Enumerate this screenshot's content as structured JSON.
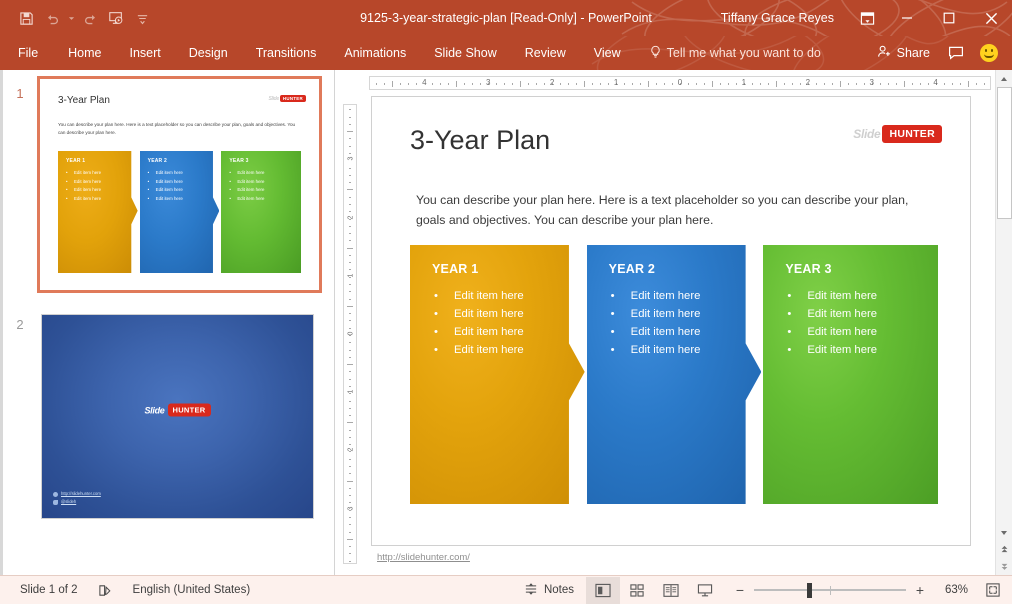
{
  "titlebar": {
    "document_title": "9125-3-year-strategic-plan [Read-Only]  -  PowerPoint",
    "user_name": "Tiffany Grace Reyes",
    "qat": [
      {
        "name": "save-icon",
        "label": "Save"
      },
      {
        "name": "undo-icon",
        "label": "Undo"
      },
      {
        "name": "undo-dropdown-icon",
        "label": "Undo options"
      },
      {
        "name": "redo-icon",
        "label": "Redo"
      },
      {
        "name": "start-presentation-icon",
        "label": "Start From Beginning"
      },
      {
        "name": "customize-qat-icon",
        "label": "Customize Quick Access Toolbar"
      }
    ],
    "window_controls": [
      {
        "name": "ribbon-display-options-icon",
        "label": "Ribbon Display Options"
      },
      {
        "name": "minimize-icon",
        "label": "Minimize"
      },
      {
        "name": "maximize-icon",
        "label": "Restore Down"
      },
      {
        "name": "close-icon",
        "label": "Close"
      }
    ]
  },
  "ribbon": {
    "tabs": [
      {
        "label": "File"
      },
      {
        "label": "Home"
      },
      {
        "label": "Insert"
      },
      {
        "label": "Design"
      },
      {
        "label": "Transitions"
      },
      {
        "label": "Animations"
      },
      {
        "label": "Slide Show"
      },
      {
        "label": "Review"
      },
      {
        "label": "View"
      }
    ],
    "tell_me": "Tell me what you want to do",
    "share_label": "Share",
    "accent_color": "#b7472a"
  },
  "thumbnails": {
    "slides": [
      {
        "number": "1",
        "selected": true
      },
      {
        "number": "2",
        "selected": false
      }
    ]
  },
  "slide": {
    "title": "3-Year Plan",
    "paragraph": "You can describe your plan here. Here is a text placeholder so you can describe your plan, goals and objectives. You can describe your plan here.",
    "url": "http://slidehunter.com/",
    "logo": {
      "slide_word": "Slide",
      "hunter_word": "HUNTER",
      "badge_color": "#d9291c"
    },
    "columns": [
      {
        "heading": "YEAR 1",
        "color": "#e0a009",
        "items": [
          "Edit item here",
          "Edit item here",
          "Edit item here",
          "Edit item here"
        ]
      },
      {
        "heading": "YEAR 2",
        "color": "#2a76c6",
        "items": [
          "Edit item here",
          "Edit item here",
          "Edit item here",
          "Edit item here"
        ]
      },
      {
        "heading": "YEAR 3",
        "color": "#63bb32",
        "items": [
          "Edit item here",
          "Edit item here",
          "Edit item here",
          "Edit item here"
        ]
      }
    ]
  },
  "slide2": {
    "logo": {
      "slide_word": "Slide",
      "hunter_word": "HUNTER"
    },
    "links": [
      {
        "icon": "globe-icon",
        "text": "http://slidehunter.com"
      },
      {
        "icon": "twitter-icon",
        "text": "@slideh"
      }
    ]
  },
  "rulers": {
    "horizontal_labels": [
      "4",
      "3",
      "2",
      "1",
      "0",
      "1",
      "2",
      "3",
      "4"
    ],
    "vertical_labels": [
      "3",
      "2",
      "1",
      "0",
      "1",
      "2",
      "3"
    ]
  },
  "statusbar": {
    "slide_counter": "Slide 1 of 2",
    "language": "English (United States)",
    "notes_label": "Notes",
    "views": [
      {
        "name": "normal-view-button",
        "active": true
      },
      {
        "name": "slide-sorter-view-button",
        "active": false
      },
      {
        "name": "reading-view-button",
        "active": false
      },
      {
        "name": "slide-show-button",
        "active": false
      }
    ],
    "zoom_out": "−",
    "zoom_in": "+",
    "zoom_percent": "63%"
  }
}
